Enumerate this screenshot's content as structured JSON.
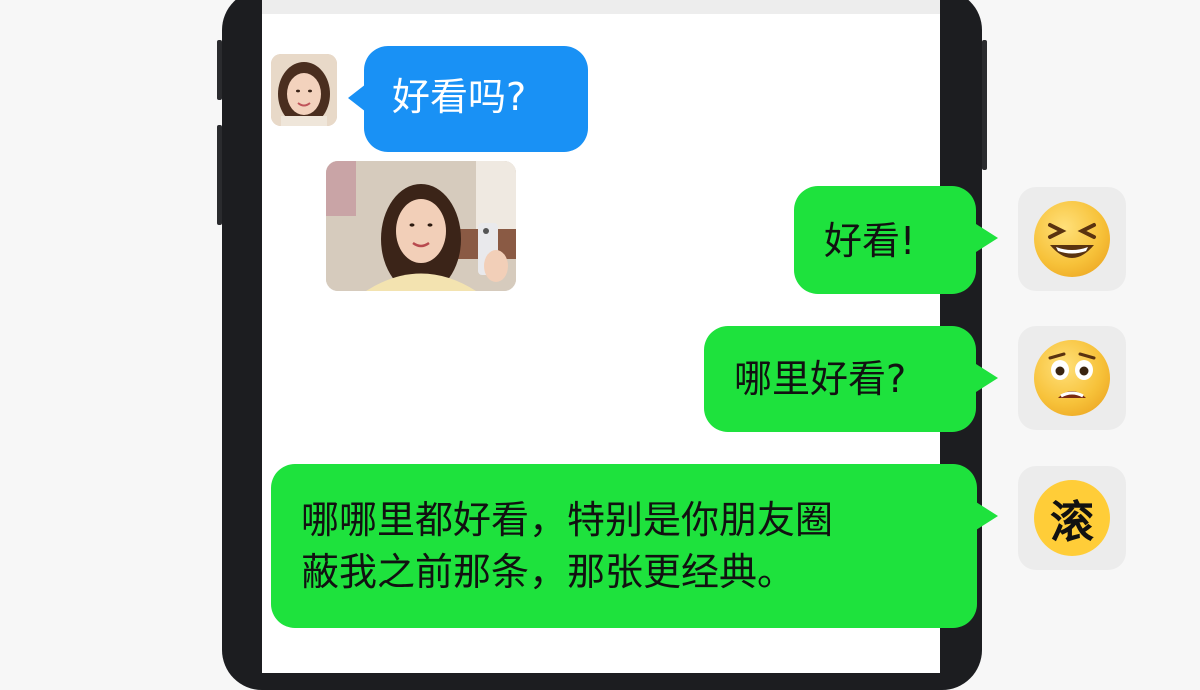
{
  "chat": {
    "messages": [
      {
        "side": "left",
        "type": "text",
        "text": "好看吗?"
      },
      {
        "side": "left",
        "type": "image",
        "alt": ""
      },
      {
        "side": "right",
        "type": "text",
        "text": "好看!"
      },
      {
        "side": "right",
        "type": "text",
        "text": "哪里好看?"
      },
      {
        "side": "right",
        "type": "text",
        "text": "哪哪里都好看，特别是你朋友圈",
        "text2": "蔽我之前那条，那张更经典。"
      }
    ],
    "reactions": [
      {
        "icon": "grinning-squint-emoji"
      },
      {
        "icon": "shocked-face-emoji"
      },
      {
        "icon": "gun-character-emoji",
        "char": "滚"
      }
    ]
  },
  "colors": {
    "incoming_bubble": "#1991f5",
    "outgoing_bubble": "#1ee23d",
    "phone_frame": "#1c1d20"
  }
}
